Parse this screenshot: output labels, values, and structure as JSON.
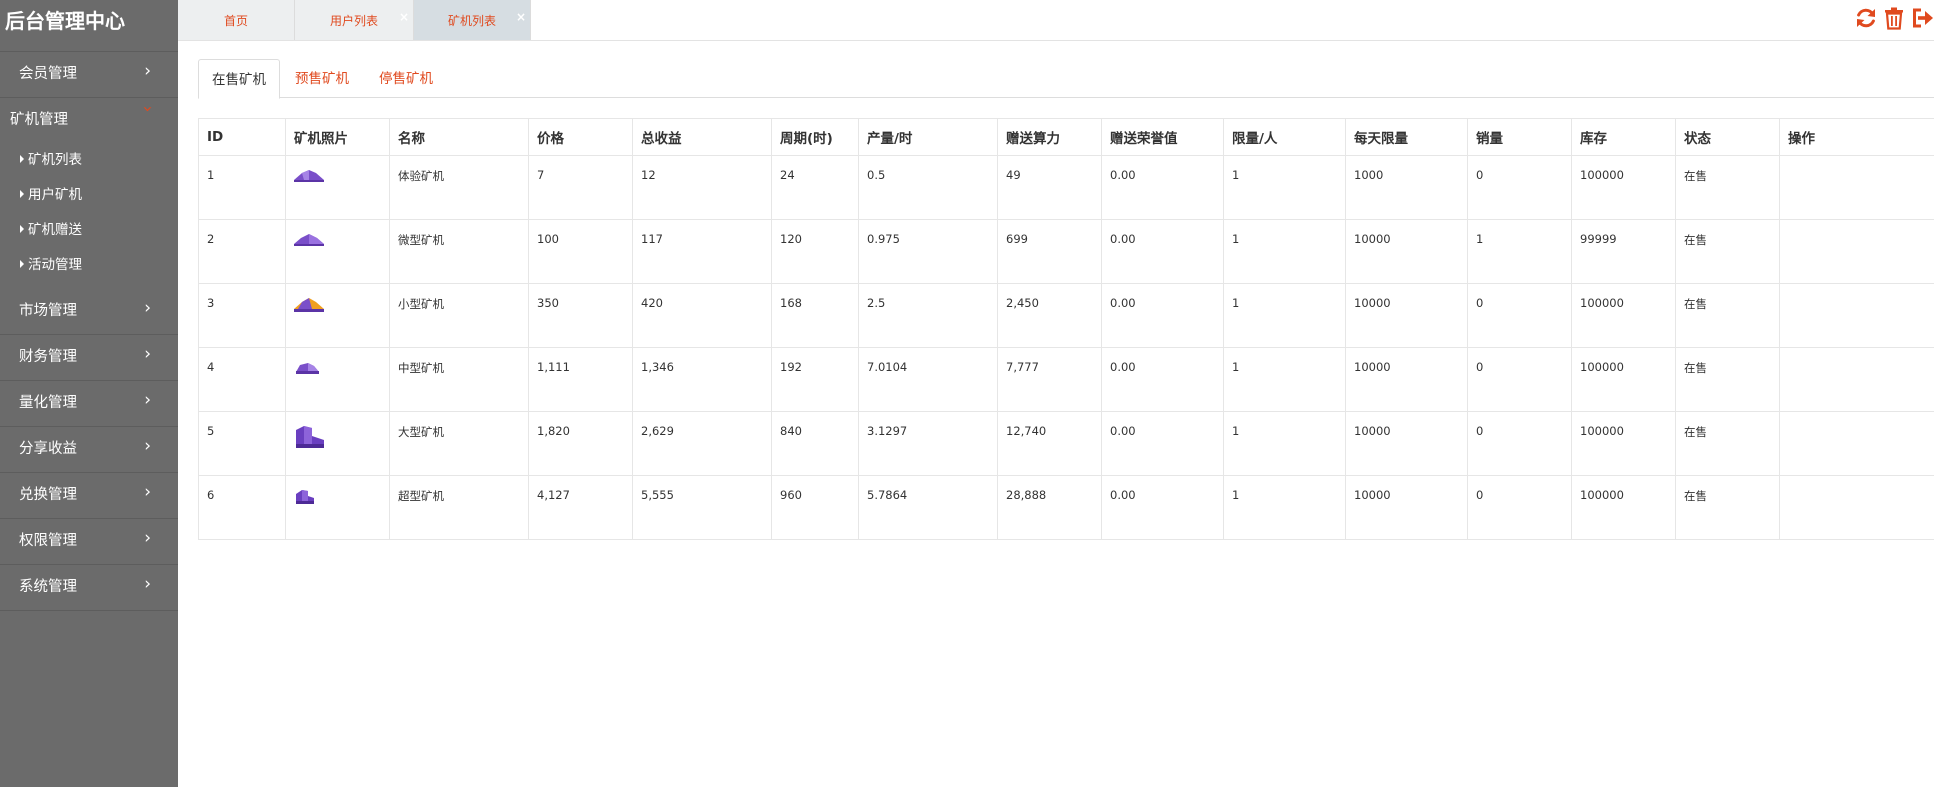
{
  "app": {
    "title": "后台管理中心"
  },
  "sidebar": {
    "groups": [
      {
        "label": "会员管理"
      },
      {
        "label": "矿机管理",
        "open": true,
        "items": [
          {
            "label": "矿机列表"
          },
          {
            "label": "用户矿机"
          },
          {
            "label": "矿机赠送"
          },
          {
            "label": "活动管理"
          }
        ]
      },
      {
        "label": "市场管理"
      },
      {
        "label": "财务管理"
      },
      {
        "label": "量化管理"
      },
      {
        "label": "分享收益"
      },
      {
        "label": "兑换管理"
      },
      {
        "label": "权限管理"
      },
      {
        "label": "系统管理"
      }
    ],
    "chevron": "›"
  },
  "topbar": {
    "tabs": [
      {
        "label": "首页",
        "closable": false
      },
      {
        "label": "用户列表",
        "closable": true
      },
      {
        "label": "矿机列表",
        "closable": true,
        "active": true
      }
    ],
    "close_glyph": "×",
    "actions": [
      "refresh-icon",
      "trash-icon",
      "logout-icon"
    ],
    "accent": "#e04a1f"
  },
  "content": {
    "tabs": [
      {
        "label": "在售矿机",
        "active": true
      },
      {
        "label": "预售矿机"
      },
      {
        "label": "停售矿机"
      }
    ],
    "table": {
      "headers": [
        "ID",
        "矿机照片",
        "名称",
        "价格",
        "总收益",
        "周期(时)",
        "产量/时",
        "赠送算力",
        "赠送荣誉值",
        "限量/人",
        "每天限量",
        "销量",
        "库存",
        "状态",
        "操作"
      ],
      "rows": [
        {
          "id": "1",
          "image": "mini-miner-icon",
          "name": "体验矿机",
          "price": "7",
          "total": "12",
          "period": "24",
          "output": "0.5",
          "power": "49",
          "honor": "0.00",
          "limit_person": "1",
          "daily": "1000",
          "sold": "0",
          "stock": "100000",
          "status": "在售",
          "ops": ""
        },
        {
          "id": "2",
          "image": "micro-miner-icon",
          "name": "微型矿机",
          "price": "100",
          "total": "117",
          "period": "120",
          "output": "0.975",
          "power": "699",
          "honor": "0.00",
          "limit_person": "1",
          "daily": "10000",
          "sold": "1",
          "stock": "99999",
          "status": "在售",
          "ops": ""
        },
        {
          "id": "3",
          "image": "small-miner-icon",
          "name": "小型矿机",
          "price": "350",
          "total": "420",
          "period": "168",
          "output": "2.5",
          "power": "2,450",
          "honor": "0.00",
          "limit_person": "1",
          "daily": "10000",
          "sold": "0",
          "stock": "100000",
          "status": "在售",
          "ops": ""
        },
        {
          "id": "4",
          "image": "medium-miner-icon",
          "name": "中型矿机",
          "price": "1,111",
          "total": "1,346",
          "period": "192",
          "output": "7.0104",
          "power": "7,777",
          "honor": "0.00",
          "limit_person": "1",
          "daily": "10000",
          "sold": "0",
          "stock": "100000",
          "status": "在售",
          "ops": ""
        },
        {
          "id": "5",
          "image": "large-miner-icon",
          "name": "大型矿机",
          "price": "1,820",
          "total": "2,629",
          "period": "840",
          "output": "3.1297",
          "power": "12,740",
          "honor": "0.00",
          "limit_person": "1",
          "daily": "10000",
          "sold": "0",
          "stock": "100000",
          "status": "在售",
          "ops": ""
        },
        {
          "id": "6",
          "image": "super-miner-icon",
          "name": "超型矿机",
          "price": "4,127",
          "total": "5,555",
          "period": "960",
          "output": "5.7864",
          "power": "28,888",
          "honor": "0.00",
          "limit_person": "1",
          "daily": "10000",
          "sold": "0",
          "stock": "100000",
          "status": "在售",
          "ops": ""
        }
      ]
    }
  }
}
